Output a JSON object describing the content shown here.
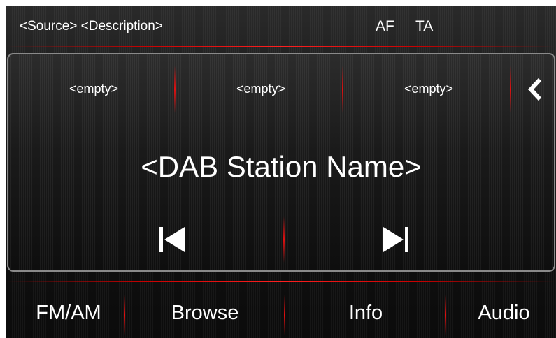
{
  "status_bar": {
    "source_description": "<Source> <Description>",
    "af_label": "AF",
    "ta_label": "TA"
  },
  "presets": [
    {
      "label": "<empty>"
    },
    {
      "label": "<empty>"
    },
    {
      "label": "<empty>"
    }
  ],
  "presets_more_icon": "chevron-left-icon",
  "station": {
    "name": "<DAB Station Name>"
  },
  "transport": {
    "previous_icon": "skip-previous-icon",
    "next_icon": "skip-next-icon"
  },
  "bottom_nav": [
    {
      "label": "FM/AM"
    },
    {
      "label": "Browse"
    },
    {
      "label": "Info"
    },
    {
      "label": "Audio"
    }
  ],
  "colors": {
    "accent_red": "#e01010",
    "text": "#ffffff",
    "background": "#111111",
    "panel_border": "#8a8a8a"
  }
}
